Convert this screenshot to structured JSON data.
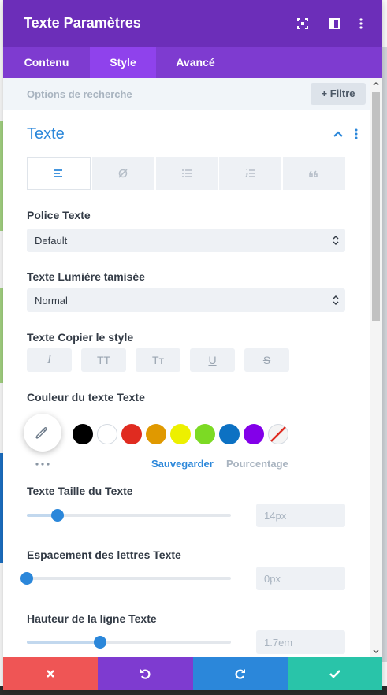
{
  "modal": {
    "title": "Texte Paramètres",
    "colors": {
      "header": "#6c2eb9",
      "tabs": "#7e3bd0",
      "active_tab": "#8f42ec",
      "accent": "#2b87da"
    },
    "header_icons": [
      "fullscreen-icon",
      "split-view-icon",
      "more-vert-icon"
    ]
  },
  "tabs": [
    {
      "label": "Contenu",
      "active": false
    },
    {
      "label": "Style",
      "active": true
    },
    {
      "label": "Avancé",
      "active": false
    }
  ],
  "search": {
    "placeholder": "Options de recherche",
    "filter_label": "+ Filtre"
  },
  "section": {
    "title": "Texte",
    "align_buttons": [
      "align-left-icon",
      "link-broken-icon",
      "bullet-list-icon",
      "numbered-list-icon",
      "quote-icon"
    ],
    "font": {
      "label": "Police Texte",
      "value": "Default"
    },
    "weight": {
      "label": "Texte Lumière tamisée",
      "value": "Normal"
    },
    "style": {
      "label": "Texte Copier le style",
      "buttons": [
        "I",
        "TT",
        "Tт",
        "U",
        "S"
      ]
    },
    "color": {
      "label": "Couleur du texte Texte",
      "swatches": [
        "#000000",
        "#ffffff",
        "#e02b20",
        "#e09900",
        "#edf000",
        "#7cda24",
        "#0c71c3",
        "#8300e9",
        "none"
      ],
      "save_label": "Sauvegarder",
      "percent_label": "Pourcentage"
    },
    "size": {
      "label": "Texte Taille du Texte",
      "value": "14px",
      "level": 0.15
    },
    "letter_spacing": {
      "label": "Espacement des lettres Texte",
      "value": "0px",
      "level": 0.0
    },
    "line_height": {
      "label": "Hauteur de la ligne Texte",
      "value": "1.7em",
      "level": 0.36
    }
  },
  "footer": {
    "buttons": [
      {
        "name": "cancel",
        "icon": "close-icon",
        "color": "#ef5555"
      },
      {
        "name": "undo",
        "icon": "undo-icon",
        "color": "#7e3bd0"
      },
      {
        "name": "redo",
        "icon": "redo-icon",
        "color": "#2b87da"
      },
      {
        "name": "save",
        "icon": "check-icon",
        "color": "#29c4a9"
      }
    ]
  }
}
